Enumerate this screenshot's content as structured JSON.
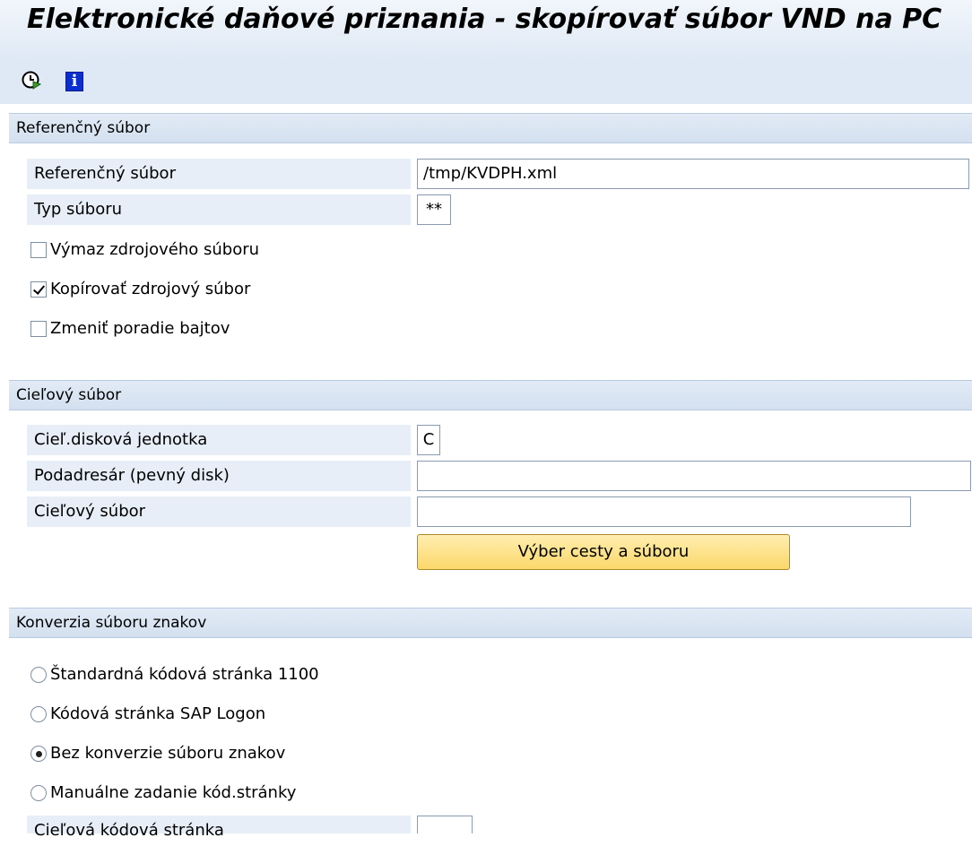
{
  "window": {
    "title": "Elektronické daňové priznania - skopírovať súbor VND na PC"
  },
  "toolbar": {
    "execute_icon": "execute-clock-icon",
    "info_icon": "info-icon",
    "info_glyph": "i"
  },
  "reference_section": {
    "header": "Referenčný súbor",
    "reference_file_label": "Referenčný súbor",
    "reference_file_value": "/tmp/KVDPH.xml",
    "file_type_label": "Typ súboru",
    "file_type_value": "**",
    "delete_source_label": "Výmaz zdrojového súboru",
    "delete_source_checked": false,
    "copy_source_label": "Kopírovať zdrojový súbor",
    "copy_source_checked": true,
    "change_byte_order_label": "Zmeniť poradie bajtov",
    "change_byte_order_checked": false
  },
  "target_section": {
    "header": "Cieľový súbor",
    "drive_label": "Cieľ.disková jednotka",
    "drive_value": "C",
    "subdir_label": "Podadresár (pevný disk)",
    "subdir_value": "",
    "target_file_label": "Cieľový súbor",
    "target_file_value": "",
    "select_path_button": "Výber cesty a súboru"
  },
  "conversion_section": {
    "header": "Konverzia súboru znakov",
    "options": [
      {
        "label": "Štandardná kódová stránka 1100",
        "selected": false
      },
      {
        "label": "Kódová stránka SAP Logon",
        "selected": false
      },
      {
        "label": "Bez konverzie súboru znakov",
        "selected": true
      },
      {
        "label": "Manuálne zadanie kód.stránky",
        "selected": false
      }
    ],
    "target_codepage_label": "Cieľová kódová stránka",
    "target_codepage_value": ""
  }
}
